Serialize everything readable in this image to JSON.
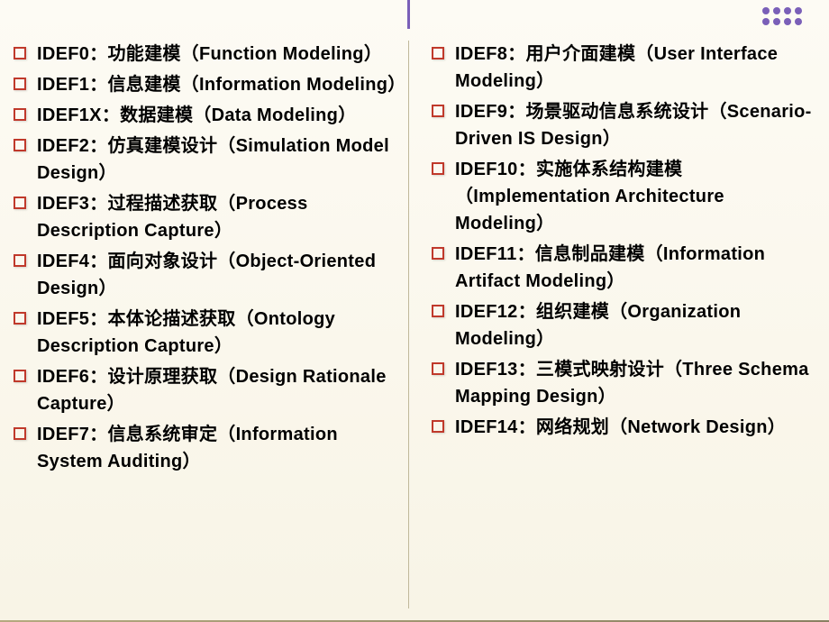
{
  "leftColumn": [
    "IDEF0：功能建模（Function Modeling）",
    "IDEF1：信息建模（Information Modeling）",
    "IDEF1X：数据建模（Data Modeling）",
    "IDEF2：仿真建模设计（Simulation Model Design）",
    "IDEF3：过程描述获取（Process Description Capture）",
    "IDEF4：面向对象设计（Object-Oriented Design）",
    "IDEF5：本体论描述获取（Ontology Description Capture）",
    "IDEF6：设计原理获取（Design Rationale Capture）",
    "IDEF7：信息系统审定（Information System Auditing）"
  ],
  "rightColumn": [
    "IDEF8：用户介面建模（User Interface Modeling）",
    "IDEF9：场景驱动信息系统设计（Scenario-Driven IS Design）",
    "IDEF10：实施体系结构建模（Implementation Architecture Modeling）",
    "IDEF11：信息制品建模（Information Artifact Modeling）",
    "IDEF12：组织建模（Organization Modeling）",
    "IDEF13：三模式映射设计（Three Schema Mapping Design）",
    "IDEF14：网络规划（Network Design）"
  ]
}
